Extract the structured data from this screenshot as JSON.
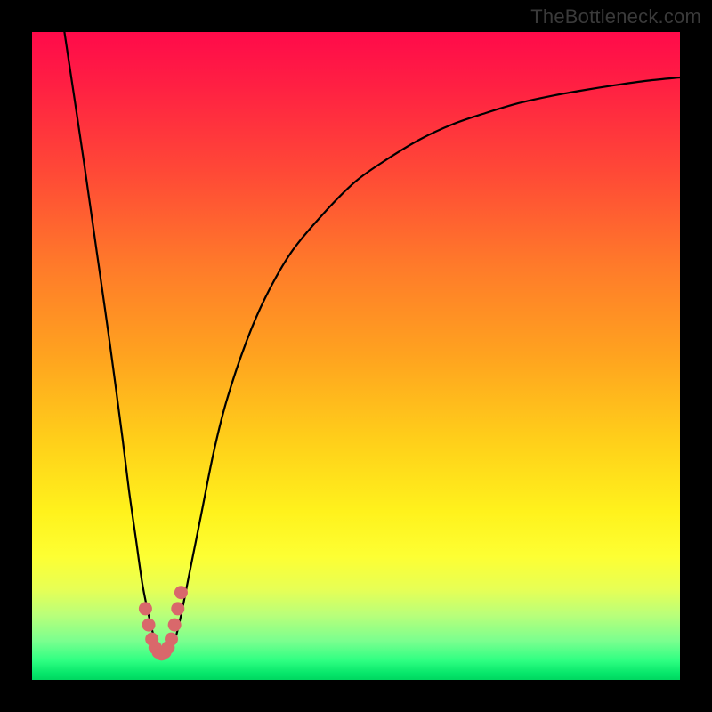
{
  "watermark": "TheBottleneck.com",
  "chart_data": {
    "type": "line",
    "title": "",
    "xlabel": "",
    "ylabel": "",
    "xlim": [
      0,
      100
    ],
    "ylim": [
      0,
      100
    ],
    "grid": false,
    "series": [
      {
        "name": "bottleneck-curve",
        "color": "#000000",
        "x": [
          5,
          8,
          10,
          12,
          14,
          15,
          16,
          17,
          18,
          19,
          20,
          21,
          22,
          23,
          24,
          26,
          28,
          30,
          33,
          36,
          40,
          45,
          50,
          55,
          60,
          65,
          70,
          75,
          80,
          85,
          90,
          95,
          100
        ],
        "values": [
          100,
          80,
          66,
          52,
          37,
          29,
          22,
          15,
          10,
          6,
          4,
          4,
          6,
          10,
          15,
          25,
          35,
          43,
          52,
          59,
          66,
          72,
          77,
          80.5,
          83.5,
          85.8,
          87.5,
          89,
          90.1,
          91,
          91.8,
          92.5,
          93
        ]
      },
      {
        "name": "highlight-dots",
        "color": "#d9686b",
        "x": [
          17.5,
          18,
          18.5,
          19,
          19.5,
          20,
          20.5,
          21,
          21.5,
          22,
          22.5,
          23
        ],
        "values": [
          11,
          8.5,
          6.3,
          5,
          4.3,
          4,
          4.3,
          5,
          6.3,
          8.5,
          11,
          13.5
        ]
      }
    ],
    "gradient_stops": [
      {
        "pos": 0,
        "color": "#ff0a4a"
      },
      {
        "pos": 8,
        "color": "#ff1f43"
      },
      {
        "pos": 22,
        "color": "#ff4a36"
      },
      {
        "pos": 36,
        "color": "#ff7a2a"
      },
      {
        "pos": 50,
        "color": "#ffa31f"
      },
      {
        "pos": 63,
        "color": "#ffcf1a"
      },
      {
        "pos": 74,
        "color": "#fff21c"
      },
      {
        "pos": 81,
        "color": "#fdff33"
      },
      {
        "pos": 86,
        "color": "#e7ff55"
      },
      {
        "pos": 90,
        "color": "#b9ff7a"
      },
      {
        "pos": 94,
        "color": "#7aff8f"
      },
      {
        "pos": 97,
        "color": "#2fff82"
      },
      {
        "pos": 99,
        "color": "#06e66a"
      },
      {
        "pos": 100,
        "color": "#00d760"
      }
    ]
  }
}
